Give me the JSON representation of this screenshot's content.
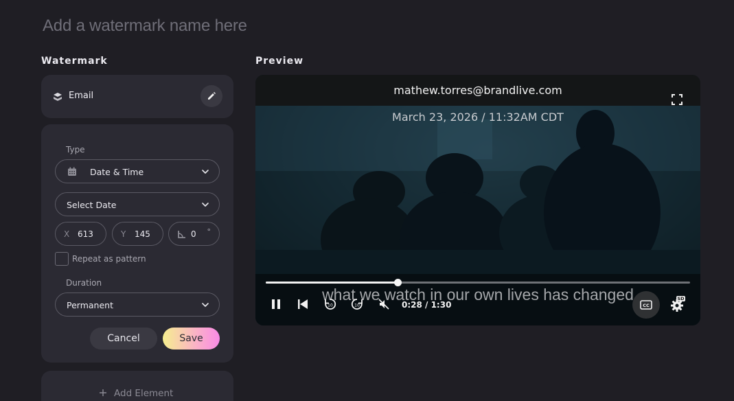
{
  "watermark_name_placeholder": "Add a watermark name here",
  "left_panel": {
    "title": "Watermark",
    "element": {
      "label": "Email",
      "icon": "stack-icon",
      "edit_icon": "pencil-icon"
    },
    "type_label": "Type",
    "type_value": "Date & Time",
    "type_icon": "calendar-icon",
    "date_select": "Select Date",
    "x_label": "X",
    "x_value": "613",
    "y_label": "Y",
    "y_value": "145",
    "rotation_value": "0",
    "rotation_unit": "°",
    "repeat_label": "Repeat as pattern",
    "repeat_checked": false,
    "duration_label": "Duration",
    "duration_value": "Permanent",
    "cancel_label": "Cancel",
    "save_label": "Save",
    "add_element_label": "Add Element"
  },
  "preview": {
    "title": "Preview",
    "email_watermark": "mathew.torres@brandlive.com",
    "date_watermark": "March 23, 2026 / 11:32AM CDT",
    "caption": "what we watch in our own lives has changed",
    "time_display": "0:28 / 1:30",
    "progress": 0.3111,
    "quality_badge": "SD",
    "controls": [
      "pause-icon",
      "skip-back-icon",
      "rewind-10-icon",
      "forward-10-icon",
      "mute-icon",
      "cc-icon",
      "settings-icon",
      "fullscreen-icon"
    ]
  },
  "colors": {
    "background": "#1f1e24",
    "card": "#2b2a33",
    "save_gradient_start": "#f5ee8f",
    "save_gradient_end": "#f88ae6"
  }
}
